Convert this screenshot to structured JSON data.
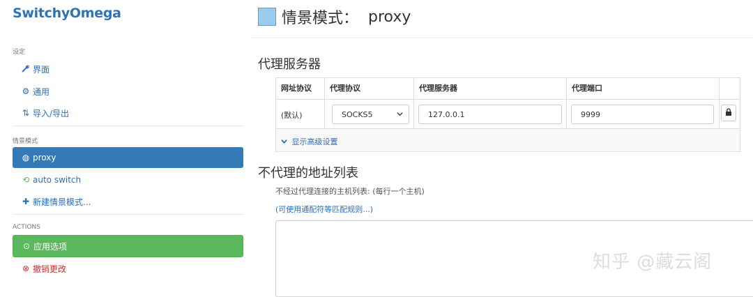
{
  "app": {
    "brand": "SwitchyOmega"
  },
  "sidebar": {
    "settings_header": "设定",
    "settings_items": [
      {
        "icon": "wrench-icon",
        "glyph": "🔧",
        "label": "界面"
      },
      {
        "icon": "gear-icon",
        "glyph": "⚙",
        "label": "通用"
      },
      {
        "icon": "import-export-icon",
        "glyph": "⇅",
        "label": "导入/导出"
      }
    ],
    "profiles_header": "情景模式",
    "profiles": [
      {
        "icon": "globe-icon",
        "glyph": "◍",
        "label": "proxy",
        "active": true
      },
      {
        "icon": "switch-icon",
        "glyph": "⟲",
        "label": "auto switch"
      },
      {
        "icon": "plus-icon",
        "glyph": "✚",
        "label": "新建情景模式..."
      }
    ],
    "actions_header": "ACTIONS",
    "actions": [
      {
        "icon": "check-circle-icon",
        "glyph": "⊙",
        "label": "应用选项"
      },
      {
        "icon": "cancel-circle-icon",
        "glyph": "⊗",
        "label": "撤销更改"
      }
    ]
  },
  "main": {
    "title_label": "情景模式：",
    "profile_name": "proxy",
    "swatch_color": "#99ccee",
    "proxy_section_title": "代理服务器",
    "table": {
      "headers": [
        "网址协议",
        "代理协议",
        "代理服务器",
        "代理端口"
      ],
      "row": {
        "scheme": "(默认)",
        "protocol": "SOCKS5",
        "server": "127.0.0.1",
        "port": "9999"
      },
      "advanced_link": "显示高级设置"
    },
    "bypass_section_title": "不代理的地址列表",
    "bypass_help": "不经过代理连接的主机列表: (每行一个主机)",
    "bypass_wildcard_link": "(可使用通配符等匹配规则...)",
    "bypass_value": ""
  },
  "watermark": "知乎 @藏云阁",
  "colors": {
    "accent": "#337ab7",
    "success": "#5cb85c",
    "danger": "#c9302c",
    "link": "#2a6fbb"
  }
}
